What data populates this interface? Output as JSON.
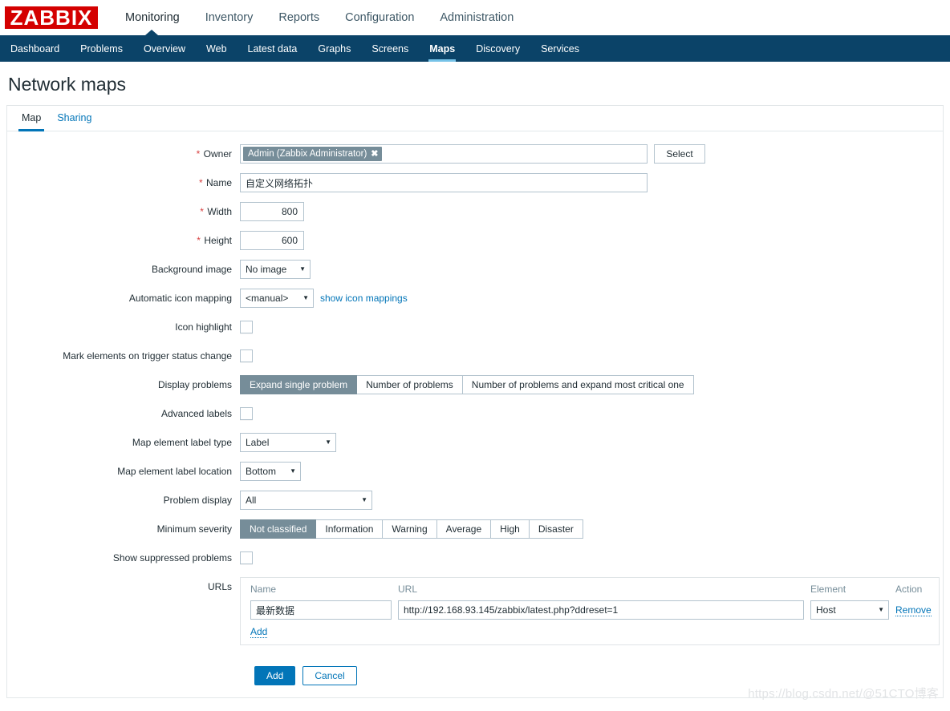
{
  "header": {
    "logo_text": "ZABBIX",
    "logo_color": "#d40000",
    "main_nav": [
      {
        "label": "Monitoring",
        "active": true
      },
      {
        "label": "Inventory",
        "active": false
      },
      {
        "label": "Reports",
        "active": false
      },
      {
        "label": "Configuration",
        "active": false
      },
      {
        "label": "Administration",
        "active": false
      }
    ],
    "sub_nav": [
      {
        "label": "Dashboard",
        "active": false
      },
      {
        "label": "Problems",
        "active": false
      },
      {
        "label": "Overview",
        "active": false
      },
      {
        "label": "Web",
        "active": false
      },
      {
        "label": "Latest data",
        "active": false
      },
      {
        "label": "Graphs",
        "active": false
      },
      {
        "label": "Screens",
        "active": false
      },
      {
        "label": "Maps",
        "active": true
      },
      {
        "label": "Discovery",
        "active": false
      },
      {
        "label": "Services",
        "active": false
      }
    ],
    "sub_nav_bg": "#0b4368",
    "active_underline": "#76c3e8"
  },
  "page": {
    "title": "Network maps"
  },
  "tabs": [
    {
      "label": "Map",
      "active": true
    },
    {
      "label": "Sharing",
      "active": false
    }
  ],
  "form": {
    "owner": {
      "label": "Owner",
      "required": true,
      "chip_value": "Admin (Zabbix Administrator)",
      "chip_remove_icon": "x-icon",
      "select_button": "Select"
    },
    "name": {
      "label": "Name",
      "required": true,
      "value": "自定义网络拓扑"
    },
    "width": {
      "label": "Width",
      "required": true,
      "value": "800"
    },
    "height": {
      "label": "Height",
      "required": true,
      "value": "600"
    },
    "background_image": {
      "label": "Background image",
      "value": "No image",
      "options": [
        "No image"
      ]
    },
    "automatic_icon_mapping": {
      "label": "Automatic icon mapping",
      "value": "<manual>",
      "options": [
        "<manual>"
      ],
      "link": "show icon mappings"
    },
    "icon_highlight": {
      "label": "Icon highlight",
      "checked": false
    },
    "mark_elements": {
      "label": "Mark elements on trigger status change",
      "checked": false
    },
    "display_problems": {
      "label": "Display problems",
      "options": [
        "Expand single problem",
        "Number of problems",
        "Number of problems and expand most critical one"
      ],
      "selected_index": 0
    },
    "advanced_labels": {
      "label": "Advanced labels",
      "checked": false
    },
    "map_element_label_type": {
      "label": "Map element label type",
      "value": "Label",
      "options": [
        "Label"
      ]
    },
    "map_element_label_location": {
      "label": "Map element label location",
      "value": "Bottom",
      "options": [
        "Bottom"
      ]
    },
    "problem_display": {
      "label": "Problem display",
      "value": "All",
      "options": [
        "All"
      ]
    },
    "minimum_severity": {
      "label": "Minimum severity",
      "options": [
        "Not classified",
        "Information",
        "Warning",
        "Average",
        "High",
        "Disaster"
      ],
      "selected_index": 0
    },
    "show_suppressed": {
      "label": "Show suppressed problems",
      "checked": false
    },
    "urls": {
      "label": "URLs",
      "columns": [
        "Name",
        "URL",
        "Element",
        "Action"
      ],
      "rows": [
        {
          "name": "最新数据",
          "url": "http://192.168.93.145/zabbix/latest.php?ddreset=1",
          "element": "Host",
          "action": "Remove"
        }
      ],
      "add_label": "Add"
    }
  },
  "footer": {
    "submit_label": "Add",
    "cancel_label": "Cancel"
  },
  "watermark": {
    "text": "https://blog.csdn.net/@51CTO博客"
  },
  "colors": {
    "accent": "#0275b8",
    "selected_segment": "#768d99",
    "required_marker": "#d73f3f",
    "border": "#b3c3ce"
  }
}
